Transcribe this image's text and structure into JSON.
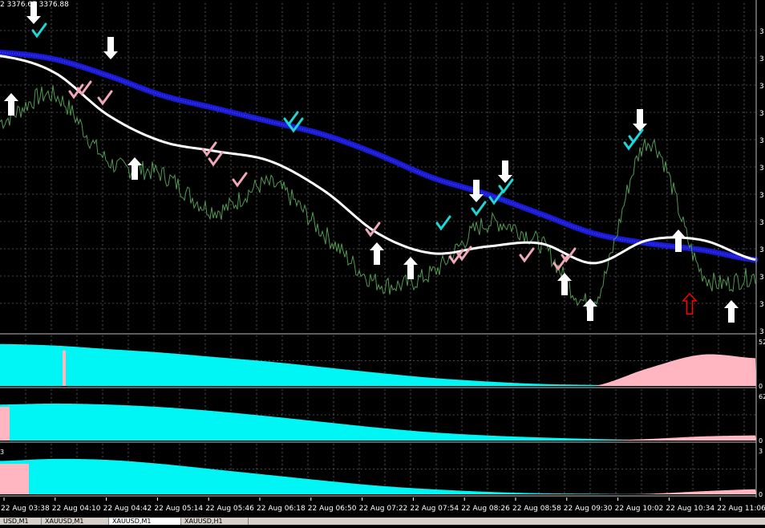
{
  "header": {
    "price_text": "2 3376.65 3376.88"
  },
  "time_labels": [
    "22 Aug 03:38",
    "22 Aug 04:10",
    "22 Aug 04:42",
    "22 Aug 05:14",
    "22 Aug 05:46",
    "22 Aug 06:18",
    "22 Aug 06:50",
    "22 Aug 07:22",
    "22 Aug 07:54",
    "22 Aug 08:26",
    "22 Aug 08:58",
    "22 Aug 09:30",
    "22 Aug 10:02",
    "22 Aug 10:34",
    "22 Aug 11:06"
  ],
  "price_axis_labels": [
    "3",
    "3",
    "3",
    "3",
    "3",
    "3",
    "3",
    "3",
    "3",
    "3",
    "3",
    "3"
  ],
  "indicator_axis_labels": [
    "52",
    "0",
    "62",
    "0",
    "3",
    "0"
  ],
  "subpanel_left_label": "3",
  "tabs": [
    {
      "label": "USD,M1"
    },
    {
      "label": "XAUUSD,M1"
    },
    {
      "label": "XAUUSD,M1"
    },
    {
      "label": "XAUUSD,H1"
    }
  ],
  "colors": {
    "background": "#000000",
    "grid": "#8a8a8a",
    "price_line": "#4f9a4f",
    "slow_ma": "#1a1ad0",
    "fast_ma": "#ffffff",
    "buy_arrow": "#ffffff",
    "signal_arrow": "#ff0000",
    "check_cyan": "#1fd6d6",
    "check_pink": "#f0a8b8",
    "hist_cyan": "#00f5f5",
    "hist_pink": "#ffb6c1"
  },
  "chart_data": {
    "type": "line",
    "x": [
      "22 Aug 03:38",
      "22 Aug 04:10",
      "22 Aug 04:42",
      "22 Aug 05:14",
      "22 Aug 05:46",
      "22 Aug 06:18",
      "22 Aug 06:50",
      "22 Aug 07:22",
      "22 Aug 07:54",
      "22 Aug 08:26",
      "22 Aug 08:58",
      "22 Aug 09:30",
      "22 Aug 10:02",
      "22 Aug 10:34",
      "22 Aug 11:06"
    ],
    "series": [
      {
        "values": [
          0.64,
          0.72,
          0.52,
          0.48,
          0.37,
          0.45,
          0.3,
          0.15,
          0.18,
          0.33,
          0.27,
          0.1,
          0.58,
          0.18,
          0.17
        ]
      },
      {
        "values": [
          0.85,
          0.83,
          0.78,
          0.72,
          0.68,
          0.64,
          0.6,
          0.54,
          0.47,
          0.42,
          0.36,
          0.3,
          0.27,
          0.25,
          0.22
        ]
      },
      {
        "values": [
          0.84,
          0.79,
          0.66,
          0.58,
          0.55,
          0.52,
          0.43,
          0.3,
          0.24,
          0.26,
          0.27,
          0.21,
          0.28,
          0.28,
          0.22
        ]
      }
    ],
    "subpanels": [
      {
        "cyan": [
          0.83,
          0.8,
          0.73,
          0.66,
          0.57,
          0.48,
          0.37,
          0.26,
          0.16,
          0.09,
          0.04,
          0.02,
          0.0,
          0.0,
          0.0
        ],
        "pink": [
          0.0,
          0.0,
          0.0,
          0.0,
          0.0,
          0.0,
          0.0,
          0.0,
          0.0,
          0.0,
          0.0,
          0.0,
          0.35,
          0.62,
          0.55
        ]
      },
      {
        "cyan": [
          0.7,
          0.72,
          0.7,
          0.65,
          0.57,
          0.47,
          0.36,
          0.25,
          0.16,
          0.1,
          0.06,
          0.03,
          0.01,
          0.0,
          0.0
        ],
        "pink": [
          0.0,
          0.0,
          0.0,
          0.0,
          0.0,
          0.0,
          0.0,
          0.0,
          0.0,
          0.0,
          0.0,
          0.0,
          0.03,
          0.08,
          0.1
        ]
      },
      {
        "cyan": [
          0.66,
          0.7,
          0.68,
          0.6,
          0.49,
          0.38,
          0.27,
          0.17,
          0.1,
          0.05,
          0.02,
          0.01,
          0.0,
          0.0,
          0.0
        ],
        "pink": [
          0.0,
          0.0,
          0.0,
          0.0,
          0.0,
          0.0,
          0.0,
          0.0,
          0.0,
          0.0,
          0.0,
          0.0,
          0.01,
          0.06,
          0.1
        ]
      }
    ]
  }
}
